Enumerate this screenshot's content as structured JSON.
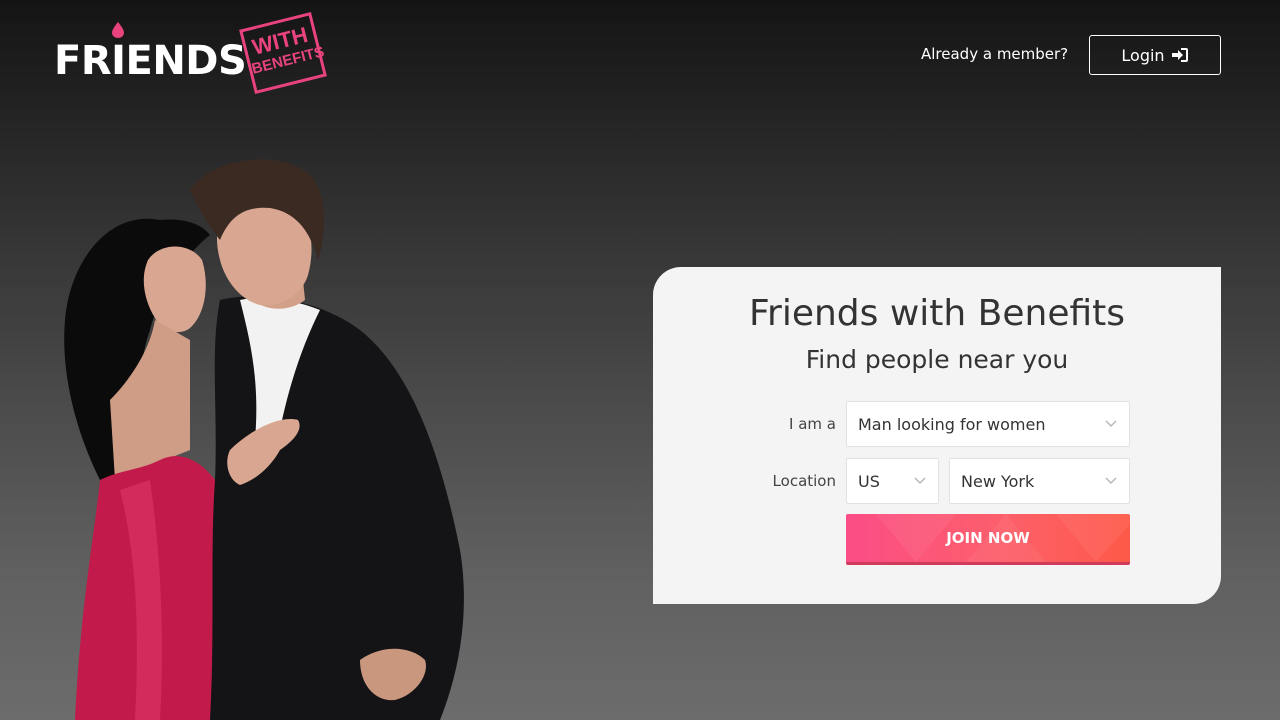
{
  "header": {
    "logo_text": "FRIENDS",
    "logo_stamp_line1": "WITH",
    "logo_stamp_line2": "BENEFITS",
    "member_prompt": "Already a member?",
    "login_label": "Login",
    "login_icon": "sign-in-icon"
  },
  "signup": {
    "title": "Friends with Benefits",
    "subtitle": "Find people near you",
    "iam_label": "I am a",
    "iam_value": "Man looking for women",
    "location_label": "Location",
    "country_value": "US",
    "city_value": "New York",
    "join_label": "JOIN NOW"
  },
  "colors": {
    "accent": "#e8437e",
    "button_start": "#fb4d86",
    "button_end": "#fe5a48",
    "card_bg": "#f4f4f4"
  }
}
